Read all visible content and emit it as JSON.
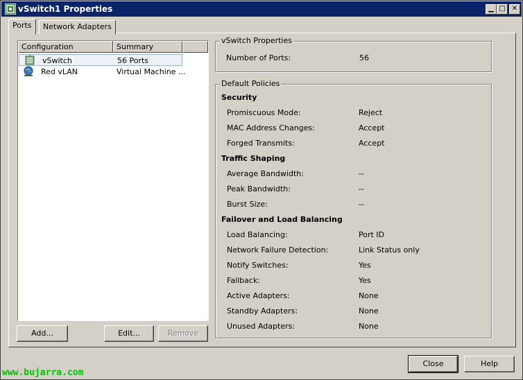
{
  "window": {
    "title": "vSwitch1 Properties"
  },
  "tabs": [
    {
      "label": "Ports"
    },
    {
      "label": "Network Adapters"
    }
  ],
  "list": {
    "columns": [
      "Configuration",
      "Summary"
    ],
    "rows": [
      {
        "config": "vSwitch",
        "summary": "56 Ports",
        "icon": "vswitch-icon"
      },
      {
        "config": "Red vLAN",
        "summary": "Virtual Machine ...",
        "icon": "network-globe-icon"
      }
    ]
  },
  "buttons": {
    "add": "Add...",
    "edit": "Edit...",
    "remove": "Remove",
    "close": "Close",
    "help": "Help"
  },
  "vswitch_properties": {
    "legend": "vSwitch Properties",
    "number_of_ports_label": "Number of Ports:",
    "number_of_ports_value": "56"
  },
  "default_policies": {
    "legend": "Default Policies",
    "security": {
      "header": "Security",
      "promiscuous_label": "Promiscuous Mode:",
      "promiscuous_value": "Reject",
      "mac_label": "MAC Address Changes:",
      "mac_value": "Accept",
      "forged_label": "Forged Transmits:",
      "forged_value": "Accept"
    },
    "traffic_shaping": {
      "header": "Traffic Shaping",
      "avg_label": "Average Bandwidth:",
      "avg_value": "--",
      "peak_label": "Peak Bandwidth:",
      "peak_value": "--",
      "burst_label": "Burst Size:",
      "burst_value": "--"
    },
    "failover": {
      "header": "Failover and Load Balancing",
      "lb_label": "Load Balancing:",
      "lb_value": "Port ID",
      "nfd_label": "Network Failure Detection:",
      "nfd_value": "Link Status only",
      "notify_label": "Notify Switches:",
      "notify_value": "Yes",
      "failback_label": "Failback:",
      "failback_value": "Yes",
      "active_label": "Active Adapters:",
      "active_value": "None",
      "standby_label": "Standby Adapters:",
      "standby_value": "None",
      "unused_label": "Unused Adapters:",
      "unused_value": "None"
    }
  },
  "watermark": "www.bujarra.com",
  "colors": {
    "titlebar": "#0a246a",
    "face": "#d4d0c8",
    "watermark": "#00c400"
  }
}
